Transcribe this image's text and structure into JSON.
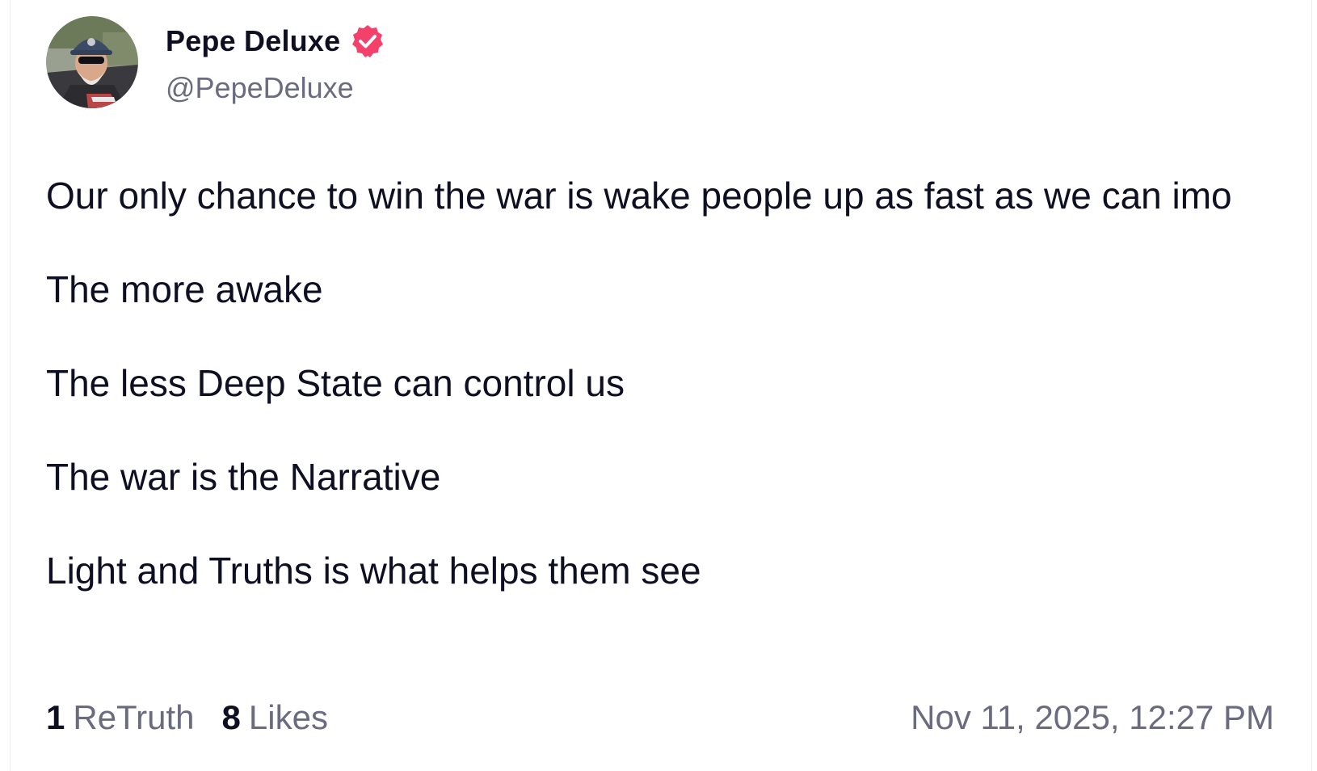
{
  "post": {
    "author": {
      "display_name": "Pepe Deluxe",
      "handle": "@PepeDeluxe",
      "verified": true,
      "verified_color": "#f4416c"
    },
    "paragraphs": [
      "Our only chance to win the war is wake people up as fast as we can imo",
      "The more awake",
      "The less Deep State can control us",
      "The war is the Narrative",
      "Light and Truths is what helps them see"
    ],
    "stats": {
      "retruths_count": "1",
      "retruths_label": "ReTruth",
      "likes_count": "8",
      "likes_label": "Likes"
    },
    "timestamp": "Nov 11, 2025, 12:27 PM"
  },
  "colors": {
    "text_primary": "#0f0f23",
    "text_secondary": "#6b6b80",
    "accent": "#f4416c"
  }
}
